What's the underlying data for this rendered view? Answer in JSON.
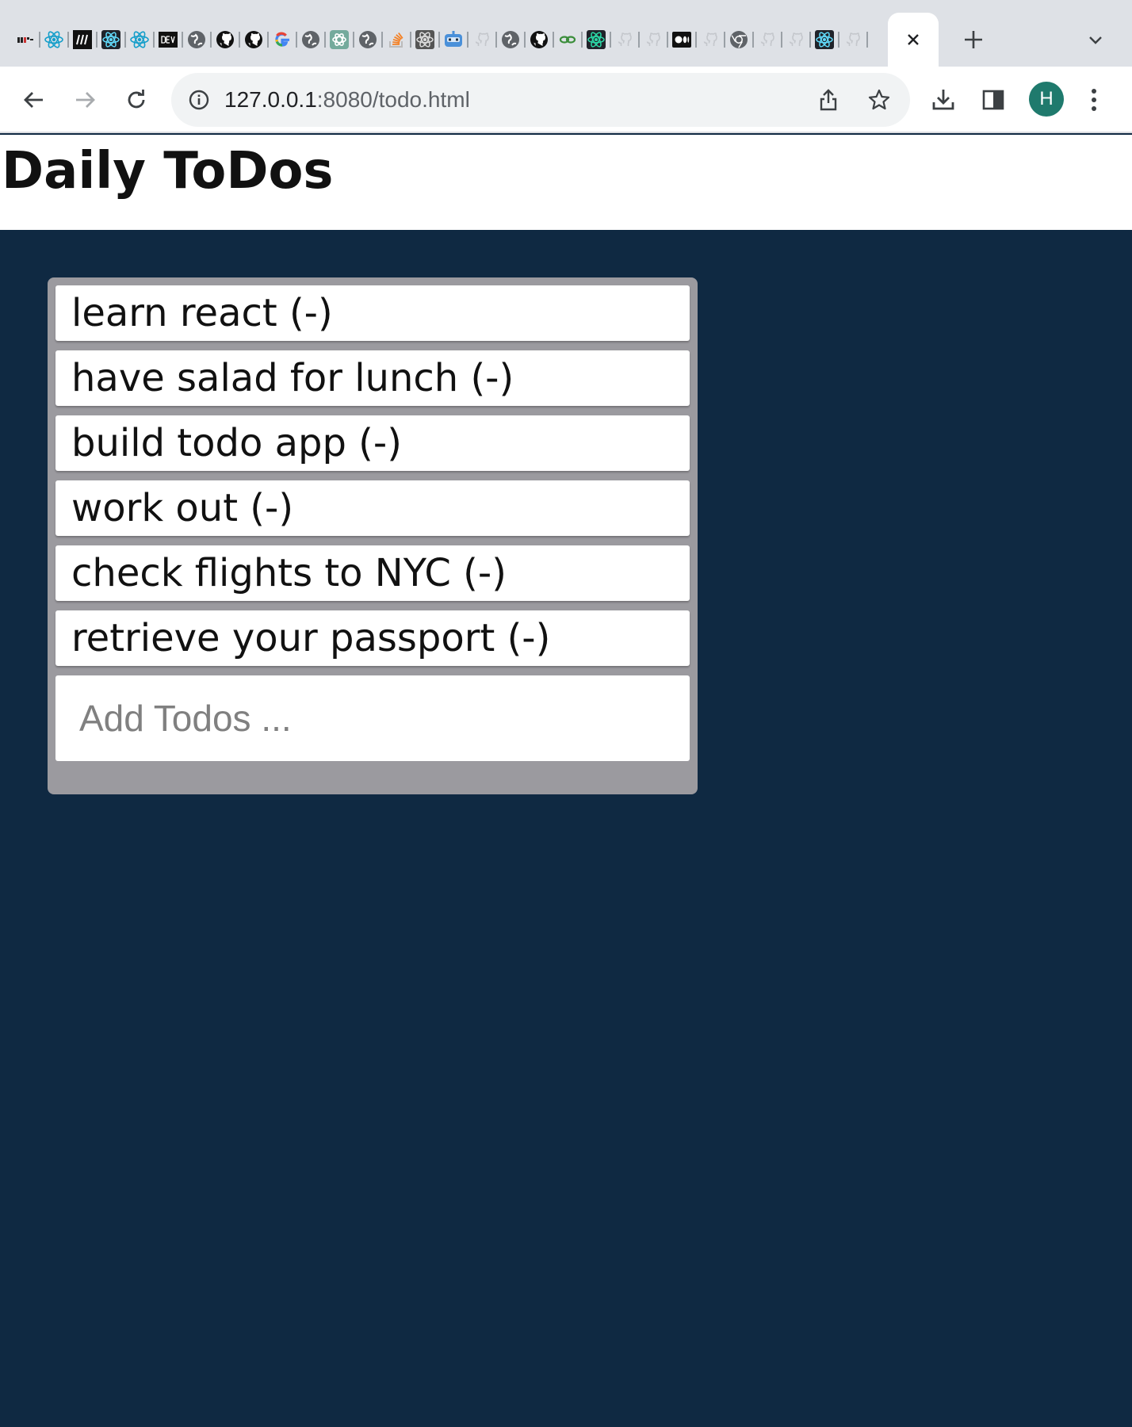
{
  "browser": {
    "tab_favicons": [
      "mit-icon",
      "react-icon",
      "medium-icon",
      "react-icon",
      "react-icon",
      "dev-icon",
      "globe-icon",
      "github-icon",
      "github-icon",
      "google-icon",
      "globe-icon",
      "chatgpt-icon",
      "globe-icon",
      "stackoverflow-icon",
      "react-icon",
      "robot-icon",
      "github-icon",
      "globe-icon",
      "github-icon",
      "link-icon",
      "react-icon",
      "github-icon",
      "github-icon",
      "medium-icon",
      "github-icon",
      "chrome-icon",
      "github-icon",
      "github-icon",
      "react-icon",
      "github-icon"
    ],
    "url_host": "127.0.0.1",
    "url_path": ":8080/todo.html",
    "profile_initial": "H",
    "colors": {
      "tabstrip": "#dee1e6",
      "toolbar": "#ffffff",
      "avatar": "#1f7a6d",
      "page_background": "#0f2942",
      "card": "#9b9a9f"
    }
  },
  "page": {
    "title": "Daily ToDos",
    "todos": [
      {
        "label": "learn react (-)"
      },
      {
        "label": "have salad for lunch (-)"
      },
      {
        "label": "build todo app (-)"
      },
      {
        "label": "work out (-)"
      },
      {
        "label": "check flights to NYC (-)"
      },
      {
        "label": "retrieve your passport (-)"
      }
    ],
    "input": {
      "placeholder": "Add Todos ...",
      "value": ""
    }
  }
}
